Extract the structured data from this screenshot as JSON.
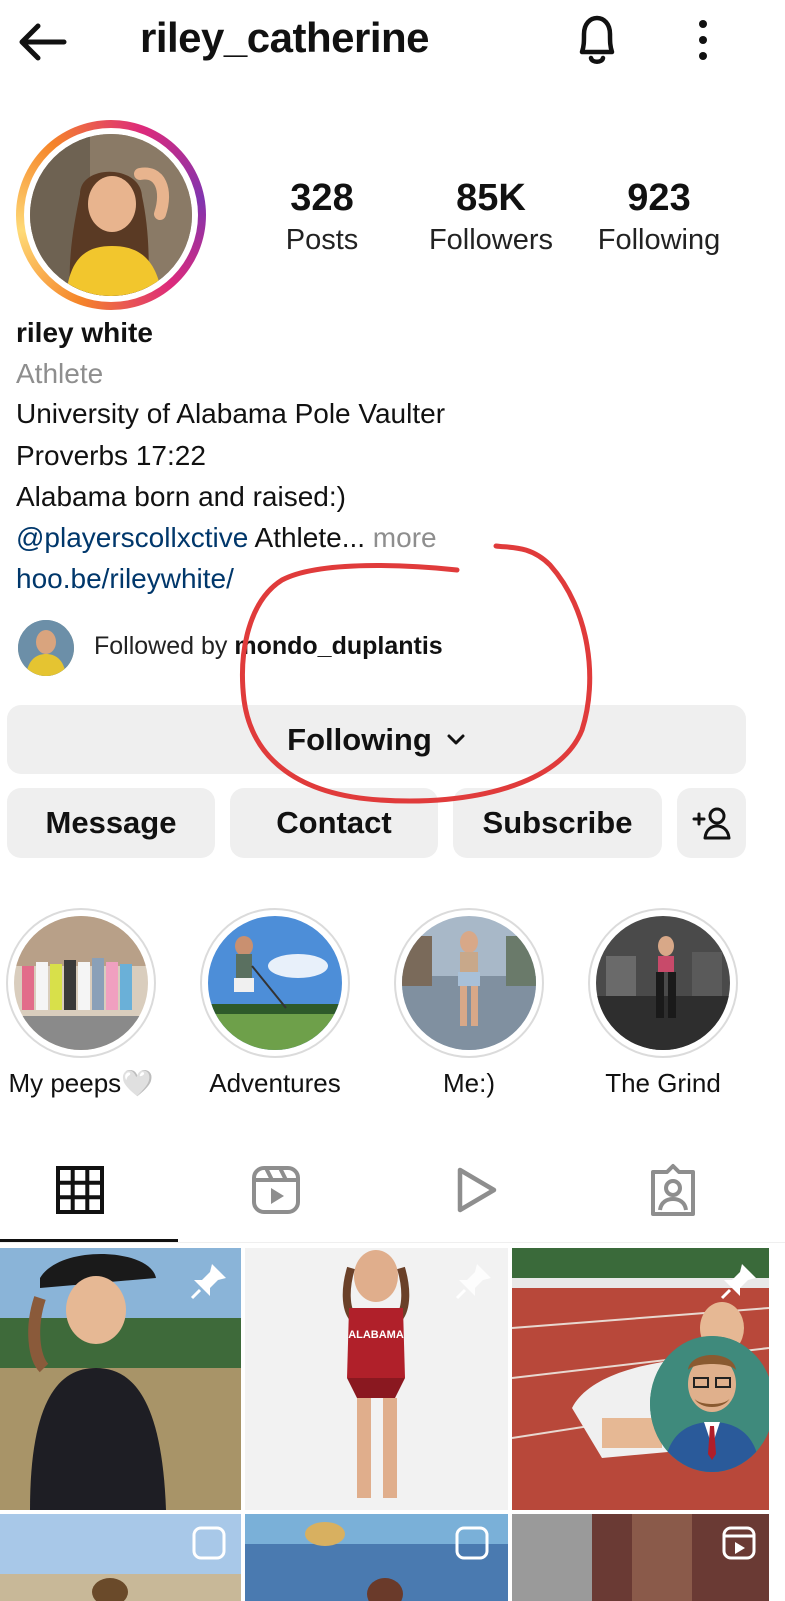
{
  "header": {
    "username": "riley_catherine",
    "back_icon": "arrow-left-icon",
    "bell_icon": "bell-icon",
    "menu_icon": "kebab-menu-icon"
  },
  "stats": {
    "posts": {
      "value": "328",
      "label": "Posts"
    },
    "followers": {
      "value": "85K",
      "label": "Followers"
    },
    "following": {
      "value": "923",
      "label": "Following"
    }
  },
  "bio": {
    "name": "riley white",
    "category": "Athlete",
    "lines": [
      "University of Alabama Pole Vaulter",
      "Proverbs 17:22",
      "Alabama born and raised:)"
    ],
    "mention": "@playerscollxctive",
    "mention_suffix": " Athlete...",
    "more": " more",
    "link": "hoo.be/rileywhite/"
  },
  "followed_by": {
    "prefix": "Followed by ",
    "user": "mondo_duplantis"
  },
  "buttons": {
    "following": "Following",
    "message": "Message",
    "contact": "Contact",
    "subscribe": "Subscribe",
    "add_user_icon": "add-user-icon"
  },
  "highlights": [
    {
      "label": "My peeps🤍"
    },
    {
      "label": "Adventures"
    },
    {
      "label": "Me:)"
    },
    {
      "label": "The Grind"
    }
  ],
  "tabs": [
    {
      "icon": "grid-icon",
      "active": true
    },
    {
      "icon": "reels-icon",
      "active": false
    },
    {
      "icon": "play-icon",
      "active": false
    },
    {
      "icon": "tagged-icon",
      "active": false
    }
  ],
  "grid": {
    "rows": 2,
    "columns": 3,
    "pinned_icon": "pin-icon",
    "tile_shirt_text": "ALABAMA"
  },
  "colors": {
    "link": "#00376b",
    "secondary_text": "#8e8e8e",
    "button_bg": "#efefef",
    "annotation_red": "#e03b3b"
  }
}
